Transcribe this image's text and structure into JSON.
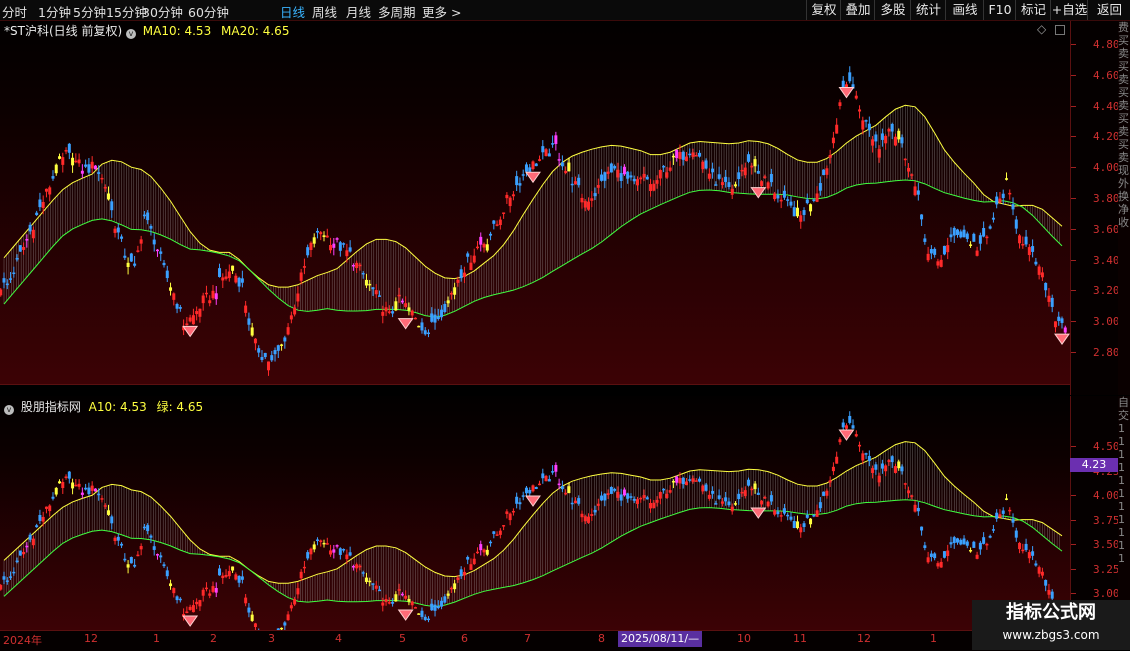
{
  "toolbar": {
    "left": [
      {
        "label": "分时",
        "active": false
      },
      {
        "label": "1分钟",
        "active": false
      },
      {
        "label": "5分钟",
        "active": false
      },
      {
        "label": "15分钟",
        "active": false
      },
      {
        "label": "30分钟",
        "active": false
      },
      {
        "label": "60分钟",
        "active": false
      },
      {
        "label": "日线",
        "active": true
      },
      {
        "label": "周线",
        "active": false
      },
      {
        "label": "月线",
        "active": false
      },
      {
        "label": "多周期",
        "active": false
      },
      {
        "label": "更多 >",
        "active": false
      }
    ],
    "right": [
      "复权",
      "叠加",
      "多股",
      "统计",
      "画线",
      "F10",
      "标记",
      "+自选",
      "返回"
    ]
  },
  "main_panel": {
    "title": "*ST沪科(日线 前复权)",
    "ma10_label": "MA10: 4.53",
    "ma20_label": "MA20: 4.65",
    "settings_glyph": "◇",
    "axis_ticks": [
      "4.80",
      "4.60",
      "4.40",
      "4.20",
      "4.00",
      "3.80",
      "3.60",
      "3.40",
      "3.20",
      "3.00",
      "2.80"
    ]
  },
  "sub_panel": {
    "title": "股朋指标网",
    "a10_label": "A10: 4.53",
    "green_label": "绿: 4.65",
    "axis_ticks": [
      "4.50",
      "4.25",
      "4.00",
      "3.75",
      "3.50",
      "3.25",
      "3.00"
    ],
    "cursor_price": "4.23"
  },
  "x_axis": {
    "labels": [
      "2024年",
      "12",
      "1",
      "2",
      "3",
      "4",
      "5",
      "6",
      "7",
      "8",
      "10",
      "11",
      "12",
      "1"
    ],
    "cursor_date": "2025/08/11/—"
  },
  "right_strip": {
    "main_chars": [
      "费",
      "买",
      "卖",
      "买",
      "卖",
      "买",
      "卖",
      "买",
      "卖",
      "买",
      "卖",
      "现",
      "外",
      "换",
      "净",
      "收"
    ],
    "sub_chars": [
      "自",
      "交",
      "1",
      "1",
      "1",
      "1",
      "1",
      "1",
      "1",
      "1",
      "1",
      "1",
      "1"
    ]
  },
  "watermark": {
    "title": "指标公式网",
    "url": "www.zbgs3.com"
  },
  "colors": {
    "up": "#ff2a2a",
    "down": "#3aa0ff",
    "ma10": "#ffff40",
    "ma20": "#40ff40",
    "accent": "#39b4ff",
    "magenta": "#ff40ff",
    "cursor": "#6b2fb0"
  },
  "chart_data": {
    "type": "candlestick",
    "ylim_main": [
      2.7,
      4.9
    ],
    "ylim_sub": [
      2.95,
      4.7
    ],
    "close_series": [
      3.3,
      3.45,
      3.6,
      3.75,
      3.9,
      4.05,
      4.15,
      4.1,
      4.05,
      4.08,
      3.95,
      3.7,
      3.5,
      3.4,
      3.75,
      3.6,
      3.4,
      3.25,
      3.05,
      3.1,
      3.2,
      3.25,
      3.35,
      3.4,
      3.3,
      2.95,
      2.85,
      2.8,
      2.9,
      3.1,
      3.35,
      3.55,
      3.65,
      3.6,
      3.55,
      3.5,
      3.4,
      3.3,
      3.2,
      3.1,
      3.2,
      3.15,
      3.05,
      3.0,
      3.1,
      3.2,
      3.35,
      3.45,
      3.55,
      3.6,
      3.7,
      3.85,
      3.95,
      4.05,
      4.1,
      4.15,
      4.2,
      4.05,
      3.95,
      3.85,
      3.9,
      4.0,
      4.05,
      4.0,
      3.95,
      4.0,
      3.95,
      4.05,
      4.1,
      4.15,
      4.2,
      4.1,
      4.0,
      3.95,
      3.9,
      4.05,
      4.1,
      4.0,
      3.95,
      3.85,
      3.8,
      3.75,
      3.85,
      3.95,
      4.15,
      4.5,
      4.65,
      4.45,
      4.3,
      4.2,
      4.35,
      4.25,
      4.1,
      3.85,
      3.5,
      3.45,
      3.55,
      3.65,
      3.6,
      3.55,
      3.6,
      3.8,
      3.95,
      3.7,
      3.55,
      3.45,
      3.3,
      3.1,
      3.05
    ]
  }
}
